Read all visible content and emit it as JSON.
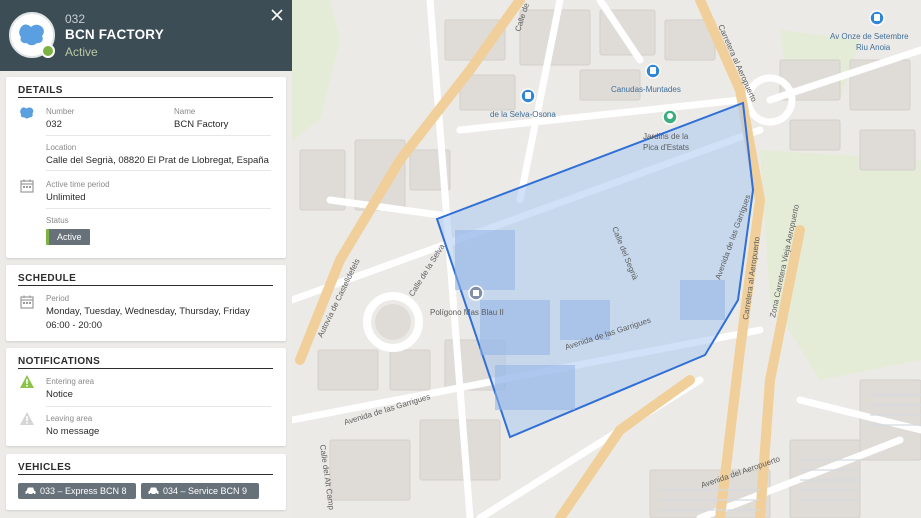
{
  "header": {
    "number": "032",
    "title": "BCN FACTORY",
    "status": "Active"
  },
  "details": {
    "title": "DETAILS",
    "number_label": "Number",
    "number_value": "032",
    "name_label": "Name",
    "name_value": "BCN Factory",
    "location_label": "Location",
    "location_value": "Calle del Segrià, 08820 El Prat de Llobregat, España",
    "period_label": "Active time period",
    "period_value": "Unlimited",
    "status_label": "Status",
    "status_value": "Active"
  },
  "schedule": {
    "title": "SCHEDULE",
    "period_label": "Period",
    "days": "Monday, Tuesday, Wednesday, Thursday, Friday",
    "hours": "06:00 - 20:00"
  },
  "notifications": {
    "title": "NOTIFICATIONS",
    "entering_label": "Entering area",
    "entering_value": "Notice",
    "leaving_label": "Leaving area",
    "leaving_value": "No message"
  },
  "vehicles": {
    "title": "VEHICLES",
    "items": [
      "033 – Express BCN 8",
      "034 – Service BCN 9"
    ]
  },
  "map": {
    "streets": {
      "autovia": "Autovía de Castelldefels",
      "selva": "Calle de la Selva",
      "garrigues_1": "Avenida de las Garrigues",
      "garrigues_2": "Avenida de las Garrigues",
      "garrigues_3": "Avenida de las Garrigues",
      "segria": "Calle del Segrià",
      "carretera_1": "Carretera al Aeropuerto",
      "carretera_2": "Carretera al Aeropuerto",
      "carretera_vieja": "Zona Carretera Vieja Aeropuerto",
      "aeropuerto": "Avenida del Aeropuerto",
      "alt_camp": "Calle del Alt Camp",
      "calle_top": "Calle de"
    },
    "places": {
      "canudas": "Canudas-Muntades",
      "selva_osona": "de la Selva-Osona",
      "jardins_1": "Jardins de la",
      "jardins_2": "Pica d'Estats",
      "poligono": "Polígono Mas Blau II",
      "onze_1": "Av Onze de Setembre",
      "onze_2": "Riu Anoia"
    },
    "colors": {
      "zone_fill": "#a9c8f2",
      "zone_stroke": "#2f6fd6",
      "major_road": "#f1cf9a",
      "minor_road": "#ffffff",
      "poi_blue": "#2f86d4",
      "poi_green": "#3daf7e"
    }
  },
  "colors": {
    "header_bg": "#3c4d55",
    "status_green": "#7cb342",
    "badge_grey": "#67717a",
    "warning_green": "#8bc34a"
  }
}
